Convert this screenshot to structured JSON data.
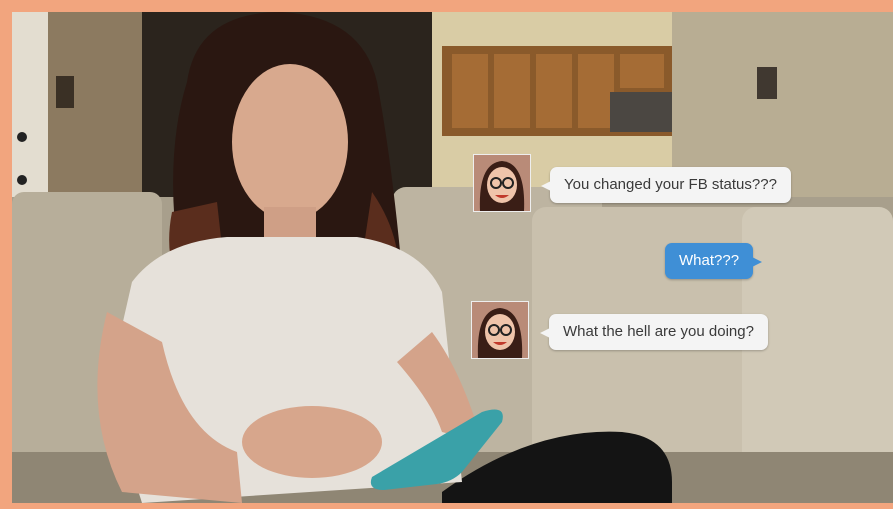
{
  "chat": {
    "messages": [
      {
        "direction": "incoming",
        "text": "You changed your FB status???",
        "avatar": "contact-avatar"
      },
      {
        "direction": "outgoing",
        "text": "What???"
      },
      {
        "direction": "incoming",
        "text": "What the hell are you doing?",
        "avatar": "contact-avatar"
      }
    ]
  },
  "colors": {
    "frame_border": "#f2a57e",
    "outgoing_bubble": "#3f8fd6",
    "incoming_bubble": "#f4f4f4"
  }
}
